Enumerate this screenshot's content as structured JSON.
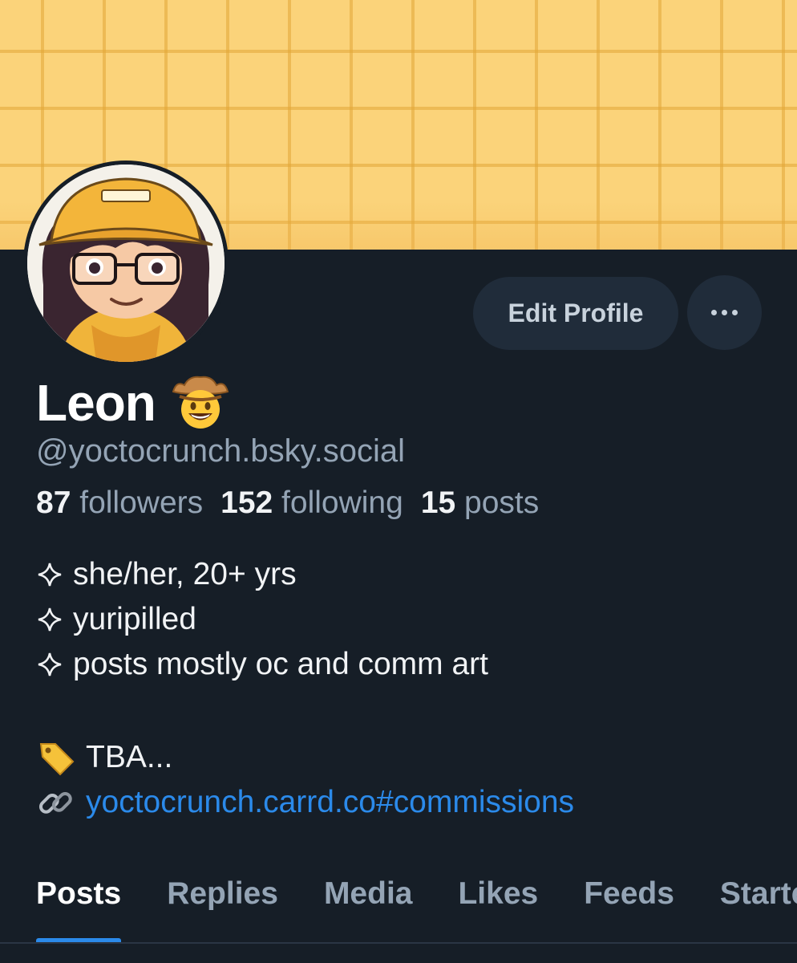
{
  "profile": {
    "display_name": "Leon",
    "name_emoji": "cowboy-face-emoji",
    "handle": "@yoctocrunch.bsky.social",
    "stats": {
      "followers_count": "87",
      "followers_label": "followers",
      "following_count": "152",
      "following_label": "following",
      "posts_count": "15",
      "posts_label": "posts"
    },
    "bio": {
      "lines": [
        "she/her, 20+ yrs",
        "yuripilled",
        "posts mostly oc and comm art"
      ],
      "tag_text": "TBA...",
      "link_text": "yoctocrunch.carrd.co#commissions"
    }
  },
  "actions": {
    "edit_profile_label": "Edit Profile",
    "more_icon": "ellipsis-icon"
  },
  "tabs": [
    {
      "label": "Posts",
      "active": true
    },
    {
      "label": "Replies"
    },
    {
      "label": "Media"
    },
    {
      "label": "Likes"
    },
    {
      "label": "Feeds"
    },
    {
      "label": "Starter Packs"
    }
  ],
  "colors": {
    "background": "#161e27",
    "banner": "#fbd37a",
    "accent_link": "#2b8aea",
    "muted_text": "#94a4b5",
    "button_bg": "#202c3a"
  }
}
